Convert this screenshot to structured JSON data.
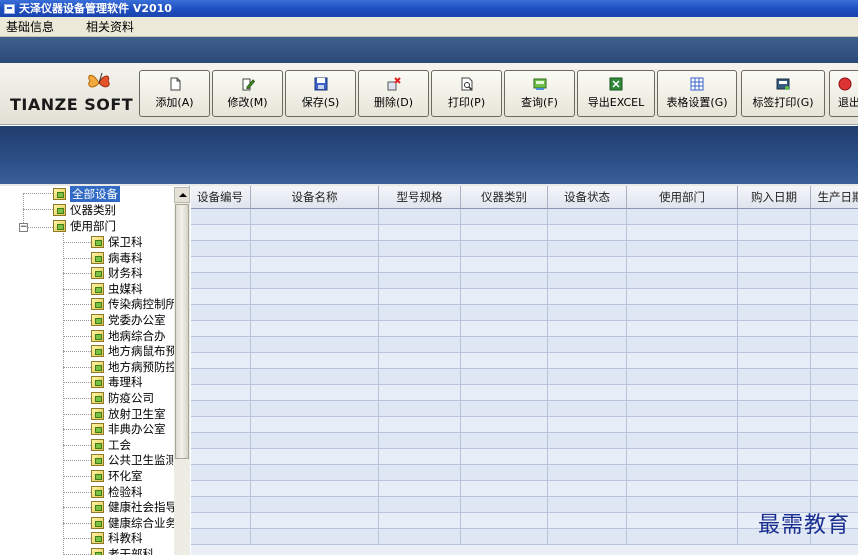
{
  "window": {
    "title": "天泽仪器设备管理软件 V2010"
  },
  "menu": {
    "items": [
      "基础信息",
      "相关资料"
    ]
  },
  "brand": {
    "logo_text": "TIANZE SOFT"
  },
  "toolbar": {
    "buttons": [
      {
        "label": "添加(A)",
        "icon": "add-document-icon"
      },
      {
        "label": "修改(M)",
        "icon": "edit-document-icon"
      },
      {
        "label": "保存(S)",
        "icon": "save-disk-icon"
      },
      {
        "label": "删除(D)",
        "icon": "delete-icon"
      },
      {
        "label": "打印(P)",
        "icon": "print-preview-icon"
      },
      {
        "label": "查询(F)",
        "icon": "query-icon"
      },
      {
        "label": "导出EXCEL",
        "icon": "excel-export-icon"
      },
      {
        "label": "表格设置(G)",
        "icon": "table-settings-icon"
      },
      {
        "label": "标签打印(G)",
        "icon": "label-print-icon"
      },
      {
        "label": "退出",
        "icon": "exit-icon"
      }
    ]
  },
  "tree": {
    "root_items": [
      "全部设备",
      "仪器类别",
      "使用部门"
    ],
    "selected": "全部设备",
    "departments": [
      "保卫科",
      "病毒科",
      "财务科",
      "虫媒科",
      "传染病控制所",
      "党委办公室",
      "地病综合办",
      "地方病鼠布预",
      "地方病预防控",
      "毒理科",
      "防疫公司",
      "放射卫生室",
      "非典办公室",
      "工会",
      "公共卫生监测",
      "环化室",
      "检验科",
      "健康社会指导",
      "健康综合业务",
      "科教科",
      "老干部科"
    ]
  },
  "grid": {
    "columns": [
      "设备编号",
      "设备名称",
      "型号规格",
      "仪器类别",
      "设备状态",
      "使用部门",
      "购入日期",
      "生产日期"
    ],
    "row_count": 21
  },
  "watermark": "最需教育",
  "colors": {
    "title_bar": "#1f4fc0",
    "band": "#2b4a78",
    "selected": "#316ac5",
    "grid_cell": "#dfe7f4"
  }
}
